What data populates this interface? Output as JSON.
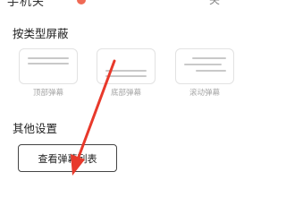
{
  "top_partial": {
    "left_text": "手机关",
    "right_text": "关"
  },
  "sections": {
    "by_type": {
      "title": "按类型屏蔽",
      "options": [
        {
          "label": "顶部弹幕"
        },
        {
          "label": "底部弹幕"
        },
        {
          "label": "滚动弹幕"
        }
      ]
    },
    "other": {
      "title": "其他设置",
      "button_label": "查看弹幕列表"
    }
  },
  "colors": {
    "accent": "#ef6a55",
    "arrow": "#e8392b",
    "card_border": "#e2e2e2",
    "muted_label": "#a6a6a6"
  },
  "annotation": {
    "icon": "red-arrow-icon"
  }
}
